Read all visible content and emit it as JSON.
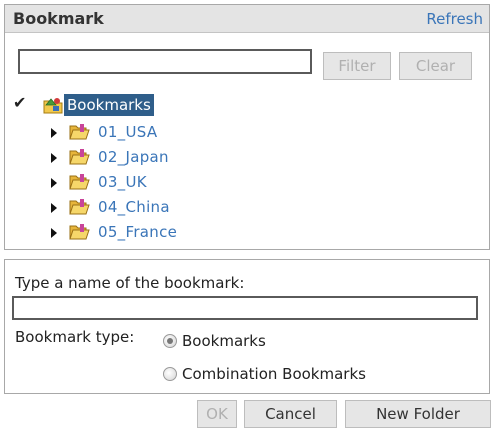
{
  "header": {
    "title": "Bookmark",
    "refresh_label": "Refresh"
  },
  "filter": {
    "value": "",
    "filter_label": "Filter",
    "clear_label": "Clear"
  },
  "tree": {
    "root": {
      "label": "Bookmarks",
      "checked": true,
      "icon": "bookmarks-root-icon"
    },
    "folders": [
      {
        "label": "01_USA",
        "icon": "folder-icon"
      },
      {
        "label": "02_Japan",
        "icon": "folder-icon"
      },
      {
        "label": "03_UK",
        "icon": "folder-icon"
      },
      {
        "label": "04_China",
        "icon": "folder-icon"
      },
      {
        "label": "05_France",
        "icon": "folder-icon"
      }
    ]
  },
  "form": {
    "name_prompt": "Type a name of the bookmark:",
    "name_value": "",
    "type_label": "Bookmark type:",
    "type_options": [
      {
        "label": "Bookmarks",
        "selected": true
      },
      {
        "label": "Combination Bookmarks",
        "selected": false
      }
    ]
  },
  "footer": {
    "ok_label": "OK",
    "cancel_label": "Cancel",
    "new_folder_label": "New Folder"
  },
  "colors": {
    "link": "#3a75b8",
    "header_bg": "#e4e4e4",
    "selected_bg": "#2f5e8a",
    "folder_yellow": "#f2c94c"
  }
}
